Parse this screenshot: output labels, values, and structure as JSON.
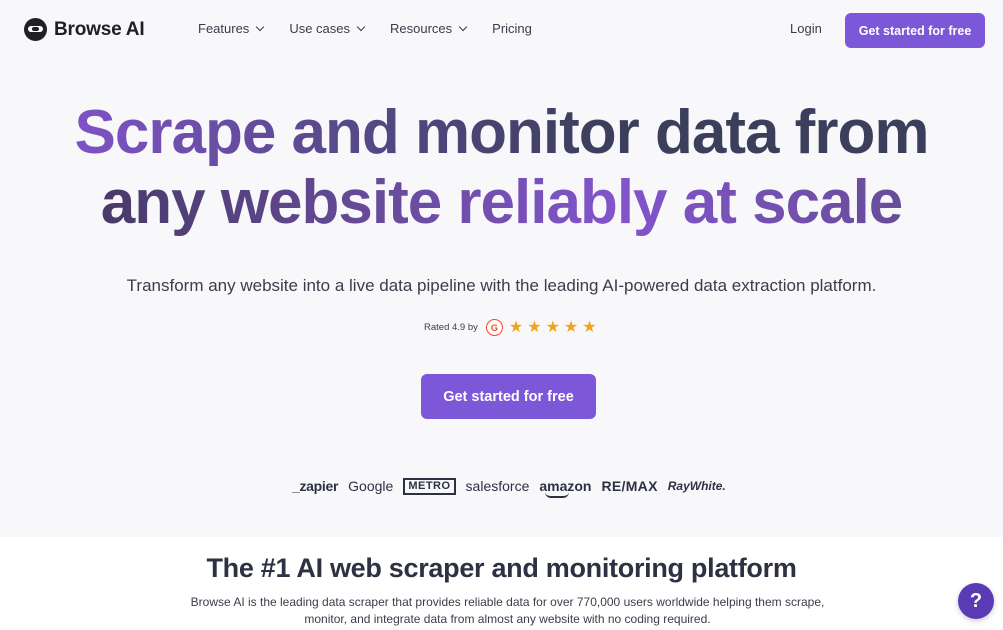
{
  "nav": {
    "brand": "Browse AI",
    "menu": [
      {
        "label": "Features",
        "has_dropdown": true
      },
      {
        "label": "Use cases",
        "has_dropdown": true
      },
      {
        "label": "Resources",
        "has_dropdown": true
      },
      {
        "label": "Pricing",
        "has_dropdown": false
      }
    ],
    "login": "Login",
    "cta": "Get started for free"
  },
  "hero": {
    "headline_line1": "Scrape and monitor data from",
    "headline_line2": "any website reliably at scale",
    "subtitle": "Transform any website into a live data pipeline with the leading AI-powered data extraction platform.",
    "rating_text": "Rated 4.9 by",
    "rating_source_icon": "g2-icon",
    "rating_badge": "G",
    "stars": 5,
    "cta": "Get started for free"
  },
  "logos": [
    "_zapier",
    "Google",
    "METRO",
    "salesforce",
    "amazon",
    "RE/MAX",
    "RayWhite."
  ],
  "section2": {
    "title": "The #1 AI web scraper and monitoring platform",
    "description": "Browse AI is the leading data scraper that provides reliable data for over 770,000 users worldwide helping them scrape, monitor, and integrate data from almost any website with no coding required."
  },
  "help_button": "?",
  "colors": {
    "accent": "#7c58d8",
    "help": "#5b3ab5",
    "star": "#f4a41c",
    "g2": "#ef4a31",
    "text": "#2d3142",
    "background": "#f8f8fa"
  }
}
